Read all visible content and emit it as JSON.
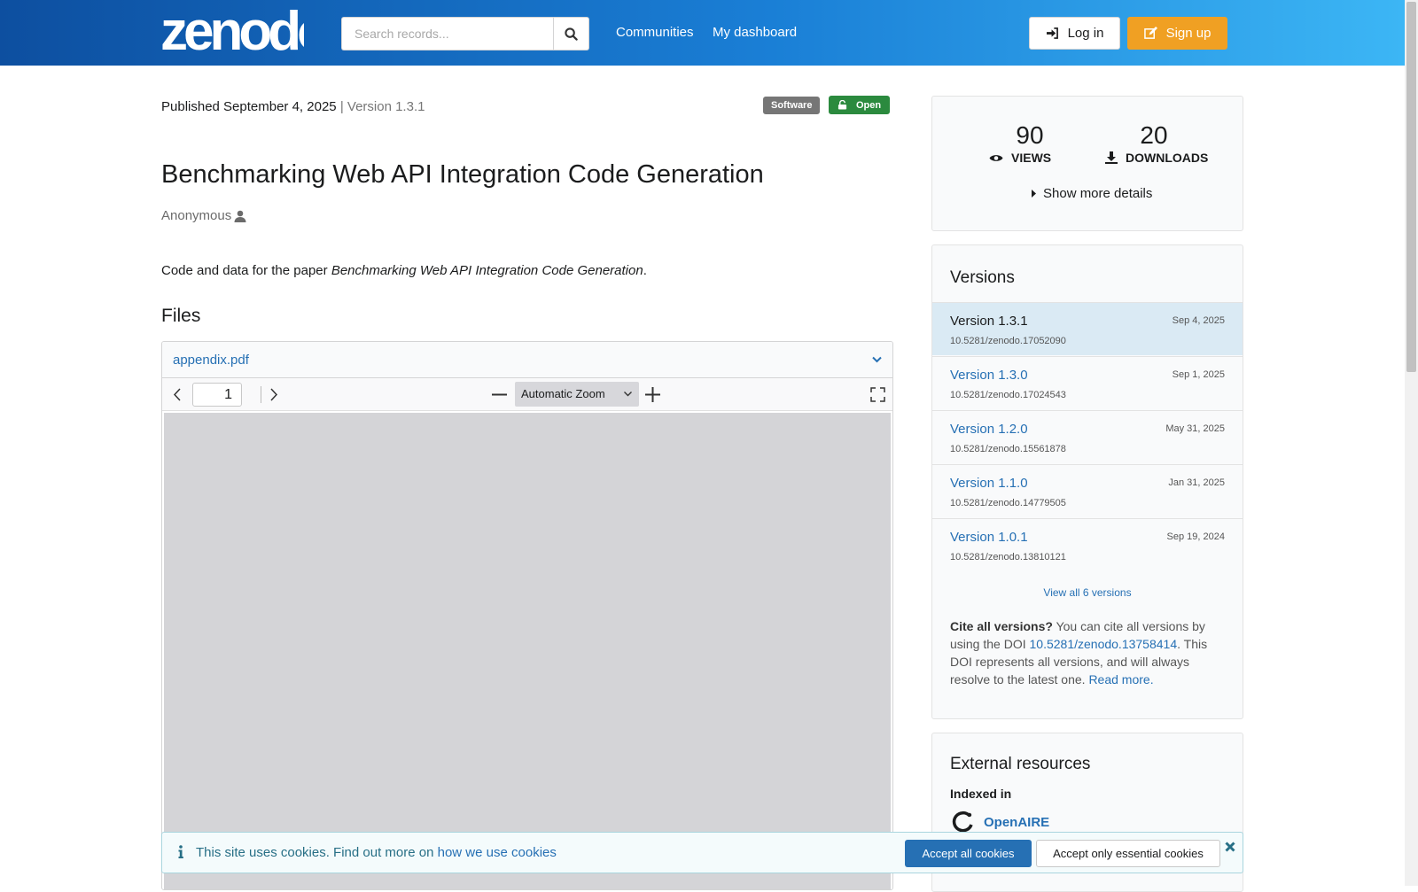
{
  "header": {
    "logo_text": "zenodo",
    "search_placeholder": "Search records...",
    "nav": [
      "Communities",
      "My dashboard"
    ],
    "login_label": "Log in",
    "signup_label": "Sign up"
  },
  "record": {
    "published_label": "Published September 4, 2025",
    "separator": "|",
    "version_label": "Version 1.3.1",
    "badge_type": "Software",
    "badge_access": "Open",
    "title": "Benchmarking Web API Integration Code Generation",
    "author": "Anonymous",
    "description_prefix": "Code and data for the paper ",
    "description_italic": "Benchmarking Web API Integration Code Generation",
    "description_suffix": "."
  },
  "files": {
    "heading": "Files",
    "filename": "appendix.pdf",
    "page_number": "1",
    "zoom_label": "Automatic Zoom"
  },
  "stats": {
    "views": "90",
    "views_label": "VIEWS",
    "downloads": "20",
    "downloads_label": "DOWNLOADS",
    "show_more": "Show more details"
  },
  "versions": {
    "heading": "Versions",
    "items": [
      {
        "name": "Version 1.3.1",
        "date": "Sep 4, 2025",
        "doi": "10.5281/zenodo.17052090",
        "active": true
      },
      {
        "name": "Version 1.3.0",
        "date": "Sep 1, 2025",
        "doi": "10.5281/zenodo.17024543",
        "active": false
      },
      {
        "name": "Version 1.2.0",
        "date": "May 31, 2025",
        "doi": "10.5281/zenodo.15561878",
        "active": false
      },
      {
        "name": "Version 1.1.0",
        "date": "Jan 31, 2025",
        "doi": "10.5281/zenodo.14779505",
        "active": false
      },
      {
        "name": "Version 1.0.1",
        "date": "Sep 19, 2024",
        "doi": "10.5281/zenodo.13810121",
        "active": false
      }
    ],
    "view_all": "View all 6 versions",
    "cite_bold": "Cite all versions?",
    "cite_text_1": " You can cite all versions by using the DOI ",
    "cite_doi": "10.5281/zenodo.13758414",
    "cite_text_2": ". This DOI represents all versions, and will always resolve to the latest one. ",
    "read_more": "Read more."
  },
  "external": {
    "heading": "External resources",
    "indexed_in": "Indexed in",
    "openaire": "OpenAIRE"
  },
  "cookie": {
    "text": "This site uses cookies. Find out more on ",
    "link": "how we use cookies",
    "accept_all": "Accept all cookies",
    "accept_essential": "Accept only essential cookies"
  },
  "colors": {
    "accent_blue": "#2670b4",
    "signup_orange": "#f0a023",
    "open_green": "#2b8a3e",
    "active_version_bg": "#daeaf4"
  }
}
